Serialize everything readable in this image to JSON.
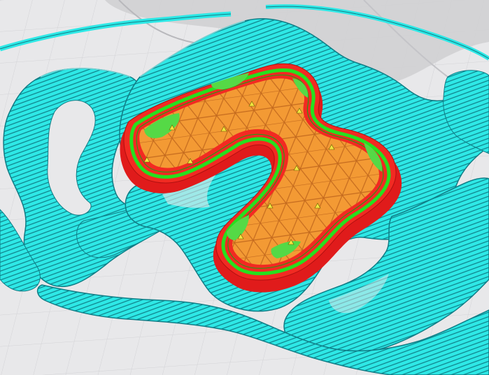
{
  "app": {
    "view": "layer-view"
  },
  "colors": {
    "background": "#e9e9ea",
    "grid": "#d2d2d6",
    "grid_major": "#c3c3c8",
    "build_volume_shadow": "#cfcfd2",
    "support": "#2ee8e6",
    "support_line": "#0c6f78",
    "wall_outer": "#ee1c1c",
    "wall_inner": "#26e01e",
    "infill": "#f39a34",
    "infill_line": "#b9651a",
    "topskin": "#55d946",
    "seam": "#f2e640"
  },
  "legend_icons": {
    "support": "support-lines",
    "wall_outer": "outer-wall",
    "wall_inner": "inner-wall",
    "infill": "infill",
    "seam": "z-seam"
  }
}
